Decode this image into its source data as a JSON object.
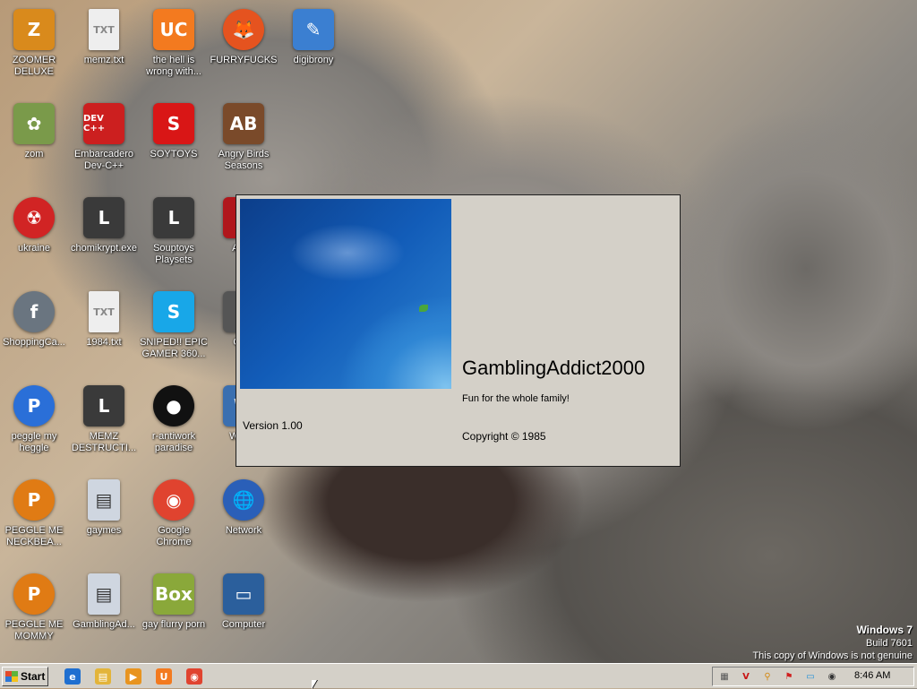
{
  "desktop_icons": [
    {
      "label": "ZOOMER DELUXE",
      "glyph": "Z",
      "color": "#d98a1c"
    },
    {
      "label": "memz.txt",
      "glyph": "TXT",
      "color": "#eeeeee"
    },
    {
      "label": "the hell is wrong with...",
      "glyph": "UC",
      "color": "#f37a1f"
    },
    {
      "label": "FURRYFUCKS",
      "glyph": "🦊",
      "color": "#e5531f"
    },
    {
      "label": "digibrony",
      "glyph": "✎",
      "color": "#3b7fd1"
    },
    {
      "label": "zom",
      "glyph": "✿",
      "color": "#7a9a4a"
    },
    {
      "label": "Embarcadero Dev-C++",
      "glyph": "DEV C++",
      "color": "#cc1f1f"
    },
    {
      "label": "SOYTOYS",
      "glyph": "S",
      "color": "#d91616"
    },
    {
      "label": "Angry Birds Seasons",
      "glyph": "AB",
      "color": "#7a4a2a"
    },
    {
      "label": "ukraine",
      "glyph": "☢",
      "color": "#d12424"
    },
    {
      "label": "chomikrypt.exe",
      "glyph": "L",
      "color": "#3a3a3a"
    },
    {
      "label": "Souptoys Playsets",
      "glyph": "L",
      "color": "#3a3a3a"
    },
    {
      "label": "Adob",
      "glyph": "A",
      "color": "#b0171c"
    },
    {
      "label": "ShoppingCa...",
      "glyph": "f",
      "color": "#6a7580"
    },
    {
      "label": "1984.txt",
      "glyph": "TXT",
      "color": "#eeeeee"
    },
    {
      "label": "SNIPED!! EPIC GAMER 360...",
      "glyph": "S",
      "color": "#18a7e8"
    },
    {
      "label": "Cont",
      "glyph": "C",
      "color": "#555555"
    },
    {
      "label": "peggle my heggle",
      "glyph": "P",
      "color": "#2a6fd8"
    },
    {
      "label": "MEMZ DESTRUCTI...",
      "glyph": "L",
      "color": "#3a3a3a"
    },
    {
      "label": "r-antiwork paradise",
      "glyph": "●",
      "color": "#111111"
    },
    {
      "label": "WIN V",
      "glyph": "W",
      "color": "#3a6fb0"
    },
    {
      "label": "PEGGLE ME NECKBEA...",
      "glyph": "P",
      "color": "#e07b14"
    },
    {
      "label": "gaymes",
      "glyph": "▤",
      "color": "#cfd6e0"
    },
    {
      "label": "Google Chrome",
      "glyph": "◉",
      "color": "#e0432f"
    },
    {
      "label": "Network",
      "glyph": "🌐",
      "color": "#2a5fb8"
    },
    {
      "label": "PEGGLE ME MOMMY",
      "glyph": "P",
      "color": "#e07b14"
    },
    {
      "label": "GamblingAd...",
      "glyph": "▤",
      "color": "#cfd6e0"
    },
    {
      "label": "gay flurry porn",
      "glyph": "Box",
      "color": "#8aa83a"
    },
    {
      "label": "Computer",
      "glyph": "▭",
      "color": "#2b5f9c"
    }
  ],
  "dialog": {
    "app_name": "GamblingAddict2000",
    "tagline": "Fun for the whole family!",
    "version": "Version 1.00",
    "copyright": "Copyright ©  1985"
  },
  "watermark": {
    "os": "Windows 7",
    "build": "Build 7601",
    "notice": "This copy of Windows is not genuine"
  },
  "taskbar": {
    "start_label": "Start",
    "quick_launch": [
      {
        "name": "internet-explorer-icon",
        "glyph": "e",
        "color": "#1f6fd0"
      },
      {
        "name": "explorer-icon",
        "glyph": "▤",
        "color": "#e3b43a"
      },
      {
        "name": "media-player-icon",
        "glyph": "▶",
        "color": "#e8941f"
      },
      {
        "name": "uc-browser-icon",
        "glyph": "U",
        "color": "#f37a1f"
      },
      {
        "name": "chrome-icon",
        "glyph": "◉",
        "color": "#e0432f"
      }
    ],
    "tray_icons": [
      {
        "name": "tray-app-icon",
        "glyph": "▦",
        "color": "#555555"
      },
      {
        "name": "tray-v-icon",
        "glyph": "V",
        "color": "#c81414"
      },
      {
        "name": "tray-search-icon",
        "glyph": "⚲",
        "color": "#d48a14"
      },
      {
        "name": "tray-flag-icon",
        "glyph": "⚑",
        "color": "#d01f1f"
      },
      {
        "name": "tray-network-icon",
        "glyph": "▭",
        "color": "#1f8fd8"
      },
      {
        "name": "tray-volume-icon",
        "glyph": "◉",
        "color": "#333333"
      }
    ],
    "clock": "8:46 AM"
  }
}
